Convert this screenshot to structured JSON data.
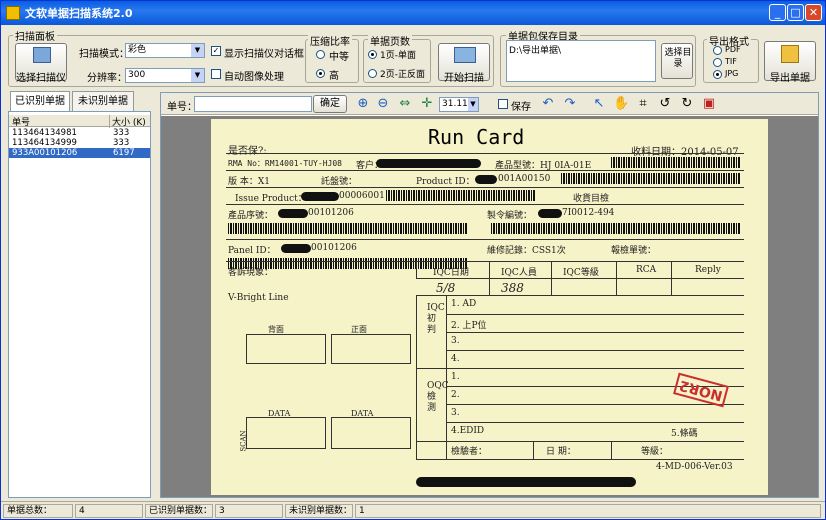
{
  "window": {
    "title": "文软单据扫描系统2.0"
  },
  "scan_panel": {
    "group_label": "扫描面板",
    "select_scanner": "选择扫描仪",
    "mode_label": "扫描模式：",
    "mode_value": "彩色",
    "resolution_label": "分辨率：",
    "resolution_value": "300",
    "show_dialog_label": "显示扫描仪对话框",
    "show_dialog_checked": true,
    "auto_process_label": "自动图像处理",
    "auto_process_checked": false
  },
  "compression": {
    "label": "压缩比率",
    "options": [
      "中等",
      "高"
    ],
    "selected": "高"
  },
  "pages": {
    "label": "单据页数",
    "options": [
      "1页-单面",
      "2页-正反面"
    ],
    "selected": "1页-单面"
  },
  "start_scan": "开始扫描",
  "save_dir": {
    "label": "单据包保存目录",
    "value": "D:\\导出单据\\",
    "browse_button": "选择目录"
  },
  "export_format": {
    "label": "导出格式",
    "options": [
      "PDF",
      "TIF",
      "JPG"
    ],
    "selected": "JPG",
    "export_button": "导出单据"
  },
  "tabs": [
    {
      "label": "已识别单据"
    },
    {
      "label": "未识别单据"
    }
  ],
  "list": {
    "headers": [
      "单号",
      "大小 (K)"
    ],
    "rows": [
      {
        "id": "113464134981",
        "size": "333"
      },
      {
        "id": "113464134999",
        "size": "333"
      },
      {
        "id": "933A00101206",
        "size": "6197"
      }
    ]
  },
  "toolbar": {
    "doc_label": "单号：",
    "confirm": "确定",
    "zoom_value": "31.11%",
    "save_label": "保存"
  },
  "document": {
    "title": "Run Card",
    "header_left": "是否保?:",
    "receive_date": "收料日期：2014-05-07",
    "rma": "RMA No：RM14001-TUY-HJ08",
    "customer": "客户：",
    "product_model": "產品型號：HJ 0IA-01E",
    "version": "版 本：X1",
    "consignment": "託盤號：",
    "product_id": "Product ID：",
    "product_id_suffix": "001A00150",
    "issue_product": "Issue Product：",
    "issue_suffix": "00006001",
    "receive_check": "收貨目檢",
    "serial": "產品序號：",
    "serial_suffix": "00101206",
    "process_code": "製令編號：",
    "process_suffix": "7I0012-494",
    "panel_id": "Panel ID：",
    "panel_suffix": "00101206",
    "repair_record": "維修記錄：CSS1次",
    "scrap_no": "報檢單號：",
    "complaint": "客訴現象：",
    "iqc_headers": [
      "IQC日期",
      "IQC人員",
      "IQC等級",
      "RCA",
      "Reply"
    ],
    "iqc_date": "5/8",
    "iqc_person": "388",
    "defect": "V-Bright Line",
    "iqc_initial": "IQC初判",
    "oqc_check": "OQC檢測",
    "rows_top": [
      "1. AD",
      "2. 上P位",
      "3.",
      "4."
    ],
    "rows_bottom": [
      "1.",
      "2.",
      "3.",
      "4.EDID",
      "5.條碼"
    ],
    "diagram_back": "背面",
    "diagram_front": "正面",
    "diagram_data": "DATA",
    "diagram_scan": "SCAN",
    "inspector": "檢驗者：",
    "date_field": "日 期：",
    "grade": "等級：",
    "stamp": "NOR2",
    "form_code": "4-MD-006-Ver.03"
  },
  "status": {
    "total_label": "单据总数：",
    "total": "4",
    "recognized_label": "已识别单据数：",
    "recognized": "3",
    "unrecognized_label": "未识别单据数：",
    "unrecognized": "1"
  }
}
